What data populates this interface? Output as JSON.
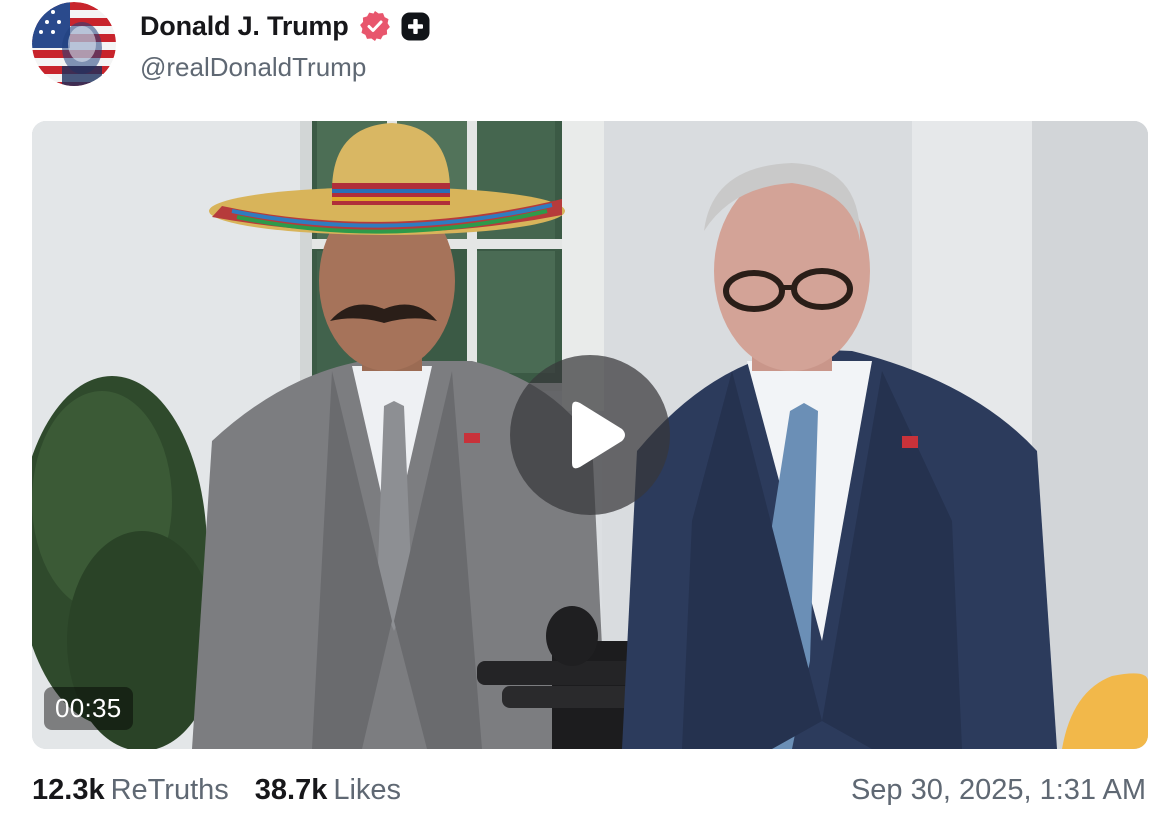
{
  "author": {
    "display_name": "Donald J. Trump",
    "handle": "@realDonaldTrump",
    "avatar_icon": "profile-avatar-flag-portrait",
    "verified_icon": "verified-badge-icon",
    "verified_color": "#e8566d",
    "plus_icon": "plus-badge-icon"
  },
  "media": {
    "type": "video",
    "duration": "00:35",
    "play_icon": "play-icon"
  },
  "stats": {
    "retruths_count": "12.3k",
    "retruths_label": "ReTruths",
    "likes_count": "38.7k",
    "likes_label": "Likes"
  },
  "timestamp": "Sep 30, 2025, 1:31 AM"
}
